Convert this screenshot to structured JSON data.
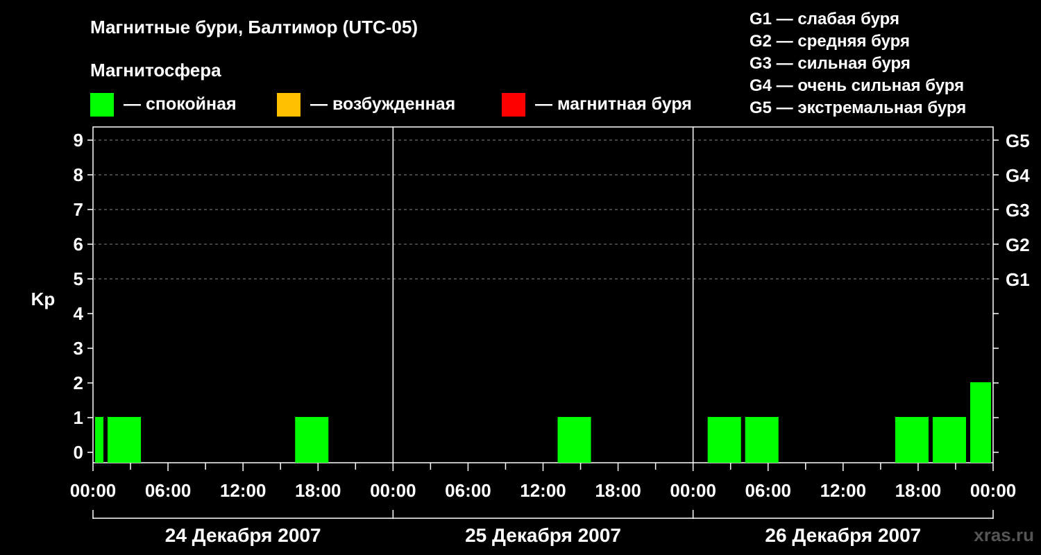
{
  "chart_data": {
    "type": "bar",
    "title": "Магнитные бури, Балтимор (UTC-05)",
    "ylabel": "Kp",
    "ylim": [
      0,
      9
    ],
    "yticks": [
      "0",
      "1",
      "2",
      "3",
      "4",
      "5",
      "6",
      "7",
      "8",
      "9"
    ],
    "right_labels": [
      {
        "kp": 5,
        "label": "G1"
      },
      {
        "kp": 6,
        "label": "G2"
      },
      {
        "kp": 7,
        "label": "G3"
      },
      {
        "kp": 8,
        "label": "G4"
      },
      {
        "kp": 9,
        "label": "G5"
      }
    ],
    "xticks": [
      "00:00",
      "06:00",
      "12:00",
      "18:00",
      "00:00",
      "06:00",
      "12:00",
      "18:00",
      "00:00",
      "06:00",
      "12:00",
      "18:00",
      "00:00"
    ],
    "days": [
      "24 Декабря 2007",
      "25 Декабря 2007",
      "26 Декабря 2007"
    ],
    "bars": [
      {
        "start_hour": 0,
        "end_hour": 1,
        "kp": 1
      },
      {
        "start_hour": 1,
        "end_hour": 4,
        "kp": 1
      },
      {
        "start_hour": 16,
        "end_hour": 19,
        "kp": 1
      },
      {
        "start_hour": 37,
        "end_hour": 40,
        "kp": 1
      },
      {
        "start_hour": 49,
        "end_hour": 52,
        "kp": 1
      },
      {
        "start_hour": 52,
        "end_hour": 55,
        "kp": 1
      },
      {
        "start_hour": 64,
        "end_hour": 67,
        "kp": 1
      },
      {
        "start_hour": 67,
        "end_hour": 70,
        "kp": 1
      },
      {
        "start_hour": 70,
        "end_hour": 72,
        "kp": 2
      }
    ],
    "grid": "dashed at Kp 5-9",
    "colors": {
      "quiet": "#00ff00",
      "active": "#ffc000",
      "storm": "#ff0000"
    }
  },
  "legend": {
    "title": "Магнитосфера",
    "items": [
      {
        "label": "— спокойная",
        "color": "#00ff00"
      },
      {
        "label": "— возбужденная",
        "color": "#ffc000"
      },
      {
        "label": "— магнитная буря",
        "color": "#ff0000"
      }
    ]
  },
  "gscale": [
    "G1 — слабая буря",
    "G2 — средняя буря",
    "G3 — сильная буря",
    "G4 — очень сильная буря",
    "G5 — экстремальная буря"
  ],
  "watermark": "xras.ru"
}
